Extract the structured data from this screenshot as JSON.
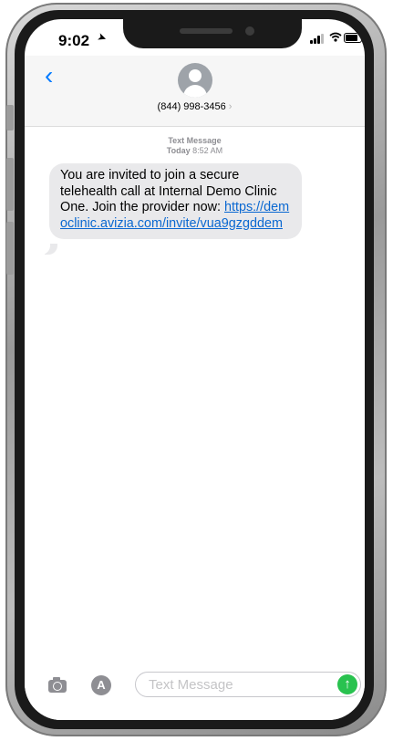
{
  "status_bar": {
    "time": "9:02"
  },
  "header": {
    "contact_name": "(844) 998-3456",
    "chevron": "›"
  },
  "thread": {
    "service_label": "Text Message",
    "day": "Today",
    "time": "8:52 AM"
  },
  "messages": [
    {
      "text_intro": "You are invited to join a secure telehealth call at Internal Demo Clinic One. Join the provider now: ",
      "link_text": "https://democlinic.avizia.com/invite/vua9gzgddem"
    }
  ],
  "compose": {
    "placeholder": "Text Message"
  },
  "icons": {
    "back": "chevron-left-icon",
    "avatar": "person-silhouette-icon",
    "camera": "camera-icon",
    "apps": "app-store-icon",
    "send": "arrow-up-icon",
    "location": "location-arrow-icon",
    "signal": "cellular-signal-icon",
    "wifi": "wifi-icon",
    "battery": "battery-icon"
  },
  "colors": {
    "accent": "#007aff",
    "bubble_incoming": "#e9e9eb",
    "link": "#0a68d1",
    "send": "#29c24f"
  }
}
